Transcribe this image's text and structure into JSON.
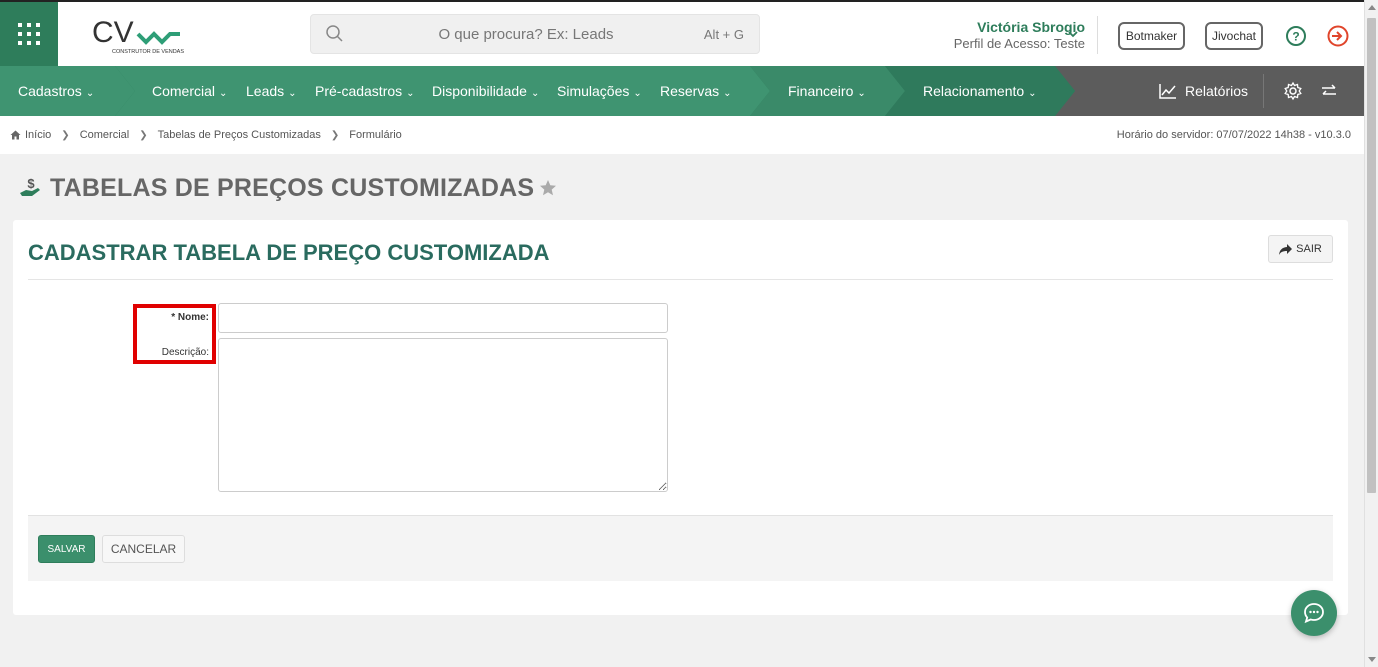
{
  "header": {
    "logo_text": "CV",
    "logo_subtitle": "CONSTRUTOR DE VENDAS",
    "search": {
      "placeholder": "O que procura? Ex: Leads",
      "shortcut": "Alt + G"
    },
    "user": {
      "name": "Victória Sbrogio",
      "profile": "Perfil de Acesso: Teste"
    },
    "buttons": {
      "botmaker": "Botmaker",
      "jivochat": "Jivochat"
    }
  },
  "nav": {
    "items": [
      {
        "label": "Cadastros"
      },
      {
        "label": "Comercial"
      },
      {
        "label": "Leads"
      },
      {
        "label": "Pré-cadastros"
      },
      {
        "label": "Disponibilidade"
      },
      {
        "label": "Simulações"
      },
      {
        "label": "Reservas"
      },
      {
        "label": "Financeiro"
      },
      {
        "label": "Relacionamento"
      }
    ],
    "reports_label": "Relatórios",
    "colors": {
      "green_dark": "#2e7d5b",
      "green_mid": "#3f9471",
      "green_light": "#4fa37f",
      "gray": "#5c5c5c"
    }
  },
  "breadcrumb": {
    "items": [
      "Início",
      "Comercial",
      "Tabelas de Preços Customizadas",
      "Formulário"
    ],
    "server_time": "Horário do servidor: 07/07/2022 14h38 - v10.3.0"
  },
  "page": {
    "title": "TABELAS DE PREÇOS CUSTOMIZADAS"
  },
  "form": {
    "title": "CADASTRAR TABELA DE PREÇO CUSTOMIZADA",
    "exit_label": "SAIR",
    "fields": {
      "nome_label": "* Nome:",
      "nome_value": "",
      "descricao_label": "Descrição:",
      "descricao_value": ""
    },
    "save_label": "SALVAR",
    "cancel_label": "CANCELAR"
  }
}
